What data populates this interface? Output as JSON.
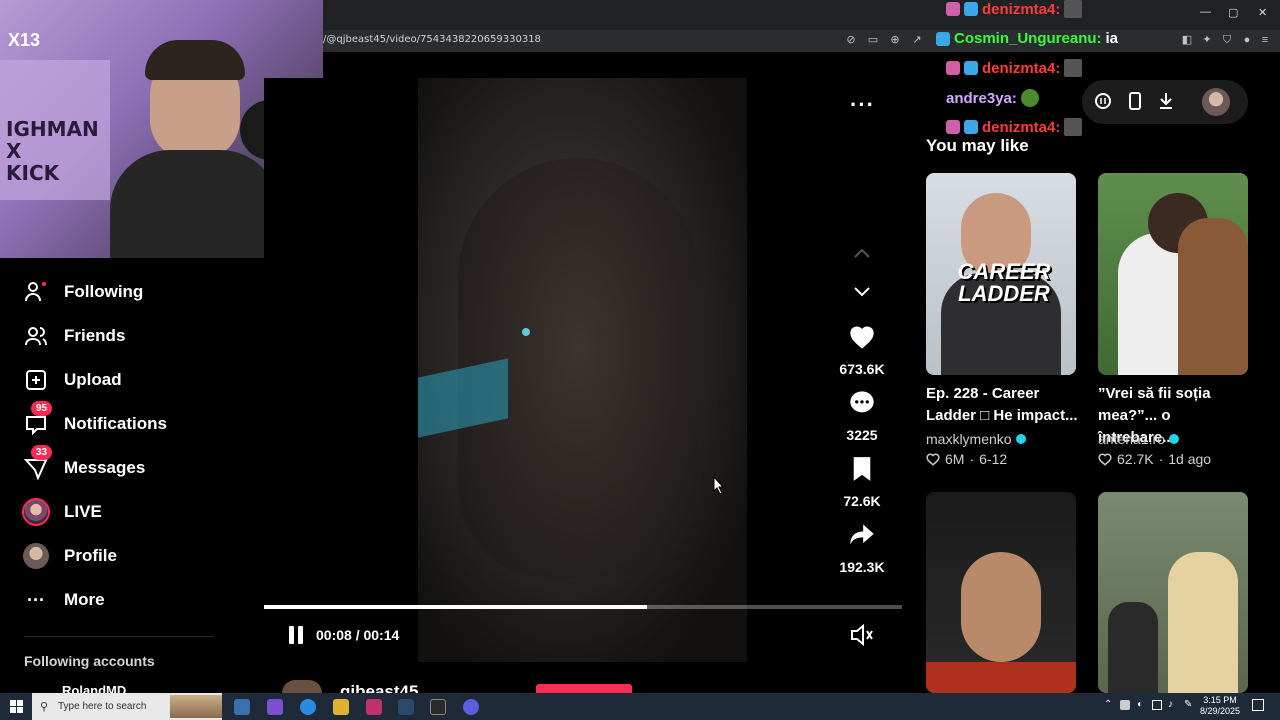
{
  "browser": {
    "url": "/@qjbeast45/video/7543438220659330318",
    "window_controls": [
      "—",
      "▢",
      "✕"
    ]
  },
  "sidebar": {
    "items": [
      {
        "label": "Following",
        "icon": "following-icon"
      },
      {
        "label": "Friends",
        "icon": "friends-icon"
      },
      {
        "label": "Upload",
        "icon": "upload-icon"
      },
      {
        "label": "Notifications",
        "icon": "notifications-icon",
        "badge": "95"
      },
      {
        "label": "Messages",
        "icon": "messages-icon",
        "badge": "33"
      },
      {
        "label": "LIVE",
        "icon": "live-avatar"
      },
      {
        "label": "Profile",
        "icon": "profile-avatar"
      },
      {
        "label": "More",
        "icon": "more-dots-icon"
      }
    ],
    "following_accounts_title": "Following accounts",
    "following_accounts": [
      "RolandMD"
    ]
  },
  "webcam": {
    "badge": "X13",
    "banner_text": "IGHMAN\nX\nKICK"
  },
  "chat": [
    {
      "user": "denizmta4:",
      "color": "#ff3b3b",
      "message": ""
    },
    {
      "user": "Cosmin_Ungureanu:",
      "color": "#35ff3a",
      "message": "ia"
    },
    {
      "user": "denizmta4:",
      "color": "#ff3b3b",
      "message": ""
    },
    {
      "user": "andre3ya:",
      "color": "#d3a8ff",
      "message": ""
    },
    {
      "user": "denizmta4:",
      "color": "#ff3b3b",
      "message": ""
    }
  ],
  "player": {
    "time": "00:08 / 00:14",
    "progress": 0.6,
    "likes": "673.6K",
    "comments": "3225",
    "bookmarks": "72.6K",
    "shares": "192.3K",
    "author_handle": "qjbeast45"
  },
  "suggestions": {
    "title": "You may like",
    "videos": [
      {
        "title": "Ep. 228 - Career Ladder □ He impact...",
        "thumb_text": "CAREER\nLADDER",
        "author": "maxklymenko",
        "verified": true,
        "likes": "6M",
        "date": "6-12"
      },
      {
        "title": "”Vrei să fii soția mea?”... o întrebare...",
        "thumb_text": "",
        "author": "antena1.ro",
        "verified": true,
        "likes": "62.7K",
        "date": "1d ago"
      },
      {
        "title": "",
        "thumb_text": "",
        "author": "",
        "likes": "",
        "date": ""
      },
      {
        "title": "",
        "thumb_text": "",
        "author": "",
        "likes": "",
        "date": ""
      }
    ]
  },
  "taskbar": {
    "search_placeholder": "Type here to search",
    "time": "3:15 PM",
    "date": "8/29/2025"
  },
  "colors": {
    "accent": "#fe2c55",
    "verified": "#20d5ec",
    "background": "#000000"
  }
}
